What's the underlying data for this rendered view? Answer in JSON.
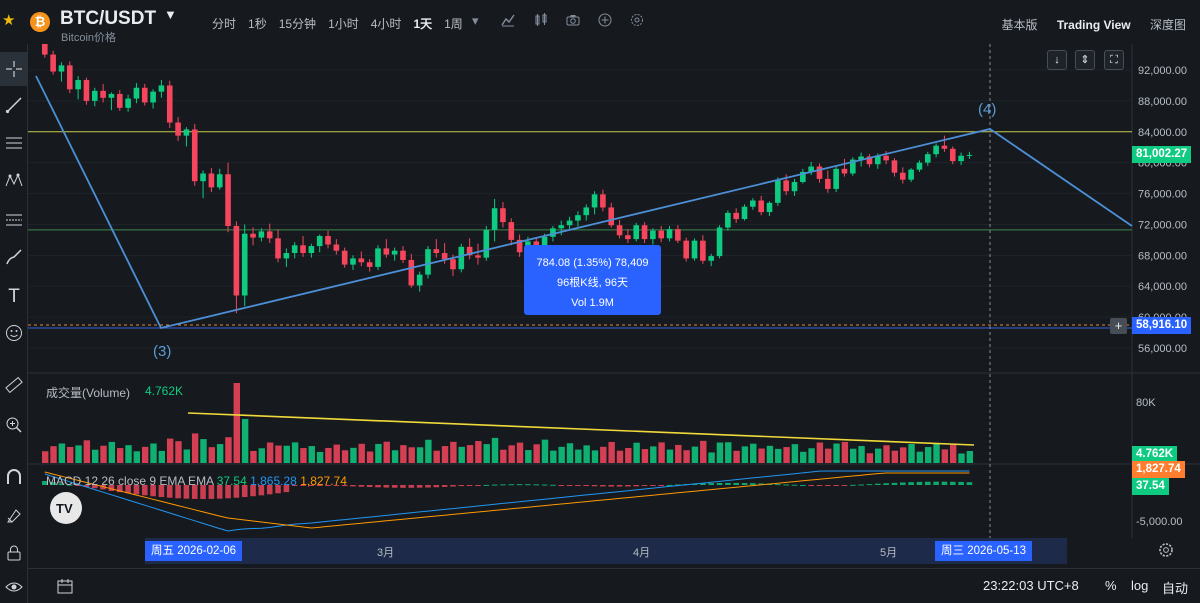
{
  "header": {
    "coin_symbol_icon": "₿",
    "symbol": "BTC/USDT",
    "subtitle": "Bitcoin价格",
    "intervals": [
      "分时",
      "1秒",
      "15分钟",
      "1小时",
      "4小时",
      "1天",
      "1周"
    ],
    "active_interval": "1天",
    "views": [
      "基本版",
      "Trading View",
      "深度图"
    ],
    "active_view": "Trading View"
  },
  "price_axis": {
    "labels": [
      "92,000.00",
      "88,000.00",
      "84,000.00",
      "80,000.00",
      "76,000.00",
      "72,000.00",
      "68,000.00",
      "64,000.00",
      "60,000.00",
      "56,000.00"
    ],
    "current_price": "81,002.27",
    "crosshair_price": "58,916.10",
    "current_price_color": "#0ecb81",
    "crosshair_price_color": "#2962ff"
  },
  "wave_labels": {
    "wave3": "(3)",
    "wave4": "(4)"
  },
  "tooltip": {
    "line1": "784.08 (1.35%) 78,409",
    "line2": "96根K线, 96天",
    "line3": "Vol 1.9M"
  },
  "volume": {
    "title": "成交量(Volume)",
    "value": "4.762K",
    "axis_label": "80K",
    "tag": "4.762K"
  },
  "macd": {
    "title": "MACD 12 26 close 9 EMA EMA",
    "hist": "37.54",
    "macd_line": "1,865.28",
    "signal": "1,827.74",
    "axis_label": "-5,000.00",
    "tag_signal": "1,827.74",
    "tag_hist": "37.54",
    "colors": {
      "hist": "#0ecb81",
      "macd": "#2196f3",
      "signal": "#ff9800"
    }
  },
  "time_axis": {
    "start_tag": "周五 2026-02-06",
    "end_tag": "周三 2026-05-13",
    "months": [
      "3月",
      "4月",
      "5月"
    ]
  },
  "status": {
    "time": "23:22:03 UTC+8",
    "percent": "%",
    "log": "log",
    "auto": "自动"
  },
  "watermark": "TV",
  "colors": {
    "up": "#0ecb81",
    "down": "#f6465d",
    "trendline": "#4d8fd6",
    "hline_yellow": "#c8c84b",
    "hline_green": "#3b8a4e"
  },
  "chart_data": {
    "type": "candlestick",
    "price_range": [
      54000,
      94000
    ],
    "h_lines": [
      84000,
      71300
    ],
    "wave_points": [
      {
        "label": "(3)",
        "price": 58000
      },
      {
        "label": "(4)",
        "price": 84000
      }
    ],
    "candles": [
      [
        95500,
        96200,
        93600,
        94000
      ],
      [
        94000,
        94500,
        91400,
        91800
      ],
      [
        91800,
        93000,
        90500,
        92600
      ],
      [
        92600,
        93100,
        89000,
        89500
      ],
      [
        89500,
        91200,
        88200,
        90700
      ],
      [
        90700,
        91000,
        87500,
        88000
      ],
      [
        88000,
        89700,
        87300,
        89300
      ],
      [
        89300,
        90200,
        87800,
        88400
      ],
      [
        88400,
        89100,
        86800,
        88900
      ],
      [
        88900,
        89400,
        86700,
        87100
      ],
      [
        87100,
        88800,
        86600,
        88300
      ],
      [
        88300,
        90300,
        87700,
        89700
      ],
      [
        89700,
        90200,
        87400,
        87800
      ],
      [
        87800,
        89500,
        87000,
        89200
      ],
      [
        89200,
        90700,
        88400,
        90000
      ],
      [
        90000,
        90600,
        84500,
        85200
      ],
      [
        85200,
        85900,
        82800,
        83500
      ],
      [
        83500,
        84600,
        82100,
        84300
      ],
      [
        84300,
        85000,
        77000,
        77600
      ],
      [
        77600,
        79000,
        75400,
        78600
      ],
      [
        78600,
        79300,
        76200,
        76800
      ],
      [
        76800,
        79200,
        76500,
        78500
      ],
      [
        78500,
        80000,
        71000,
        71800
      ],
      [
        71800,
        72400,
        60500,
        62800
      ],
      [
        62800,
        72000,
        61400,
        70800
      ],
      [
        70800,
        71600,
        69300,
        70300
      ],
      [
        70300,
        71500,
        69800,
        71100
      ],
      [
        71100,
        72100,
        69600,
        70200
      ],
      [
        70200,
        71400,
        67100,
        67600
      ],
      [
        67600,
        68900,
        66500,
        68300
      ],
      [
        68300,
        69700,
        67600,
        69300
      ],
      [
        69300,
        70500,
        67800,
        68300
      ],
      [
        68300,
        69500,
        67700,
        69200
      ],
      [
        69200,
        70700,
        68400,
        70500
      ],
      [
        70500,
        71200,
        68900,
        69400
      ],
      [
        69400,
        70100,
        68100,
        68600
      ],
      [
        68600,
        69000,
        66400,
        66800
      ],
      [
        66800,
        68000,
        66100,
        67600
      ],
      [
        67600,
        68500,
        66600,
        67100
      ],
      [
        67100,
        67500,
        65900,
        66500
      ],
      [
        66500,
        69300,
        66100,
        68900
      ],
      [
        68900,
        70100,
        67700,
        68100
      ],
      [
        68100,
        69000,
        67300,
        68600
      ],
      [
        68600,
        69200,
        67000,
        67400
      ],
      [
        67400,
        68200,
        63800,
        64100
      ],
      [
        64100,
        65900,
        63300,
        65500
      ],
      [
        65500,
        69200,
        65000,
        68800
      ],
      [
        68800,
        70100,
        67700,
        68300
      ],
      [
        68300,
        69600,
        66900,
        67500
      ],
      [
        67500,
        68100,
        65300,
        66200
      ],
      [
        66200,
        69500,
        65800,
        69100
      ],
      [
        69100,
        70200,
        67500,
        68000
      ],
      [
        68000,
        69500,
        66800,
        67700
      ],
      [
        67700,
        71800,
        67300,
        71300
      ],
      [
        71300,
        75300,
        69800,
        74100
      ],
      [
        74100,
        74900,
        71600,
        72300
      ],
      [
        72300,
        72800,
        69300,
        70000
      ],
      [
        70000,
        70700,
        67800,
        68400
      ],
      [
        68400,
        70400,
        67700,
        69800
      ],
      [
        69800,
        70200,
        66700,
        67200
      ],
      [
        67200,
        70800,
        67000,
        70400
      ],
      [
        70400,
        71800,
        69800,
        71500
      ],
      [
        71500,
        72500,
        70600,
        71900
      ],
      [
        71900,
        73000,
        71300,
        72500
      ],
      [
        72500,
        73700,
        71700,
        73200
      ],
      [
        73200,
        74600,
        72500,
        74200
      ],
      [
        74200,
        76300,
        73300,
        75900
      ],
      [
        75900,
        76500,
        73700,
        74200
      ],
      [
        74200,
        74800,
        71600,
        71900
      ],
      [
        71900,
        72600,
        70200,
        70600
      ],
      [
        70600,
        71400,
        69600,
        70100
      ],
      [
        70100,
        72200,
        69800,
        71900
      ],
      [
        71900,
        72300,
        69600,
        70100
      ],
      [
        70100,
        71500,
        69400,
        71200
      ],
      [
        71200,
        71800,
        69700,
        70200
      ],
      [
        70200,
        71800,
        69800,
        71400
      ],
      [
        71400,
        71900,
        69600,
        69900
      ],
      [
        69900,
        70300,
        67200,
        67600
      ],
      [
        67600,
        70200,
        67300,
        69900
      ],
      [
        69900,
        70600,
        66900,
        67300
      ],
      [
        67300,
        68200,
        66600,
        67900
      ],
      [
        67900,
        71900,
        67600,
        71600
      ],
      [
        71600,
        73800,
        71200,
        73500
      ],
      [
        73500,
        74100,
        72200,
        72700
      ],
      [
        72700,
        74600,
        72500,
        74300
      ],
      [
        74300,
        75400,
        73900,
        75100
      ],
      [
        75100,
        75700,
        73200,
        73600
      ],
      [
        73600,
        75000,
        73100,
        74800
      ],
      [
        74800,
        78100,
        74400,
        77700
      ],
      [
        77700,
        78500,
        75800,
        76300
      ],
      [
        76300,
        77900,
        75700,
        77500
      ],
      [
        77500,
        79200,
        77300,
        78800
      ],
      [
        78800,
        80100,
        78400,
        79500
      ],
      [
        79500,
        79900,
        77400,
        77900
      ],
      [
        77900,
        79000,
        76100,
        76600
      ],
      [
        76600,
        79600,
        76200,
        79200
      ],
      [
        79200,
        80500,
        78200,
        78600
      ],
      [
        78600,
        80700,
        78300,
        80400
      ],
      [
        80400,
        81300,
        79500,
        80800
      ],
      [
        80800,
        81100,
        79400,
        79800
      ],
      [
        79800,
        81200,
        79200,
        80900
      ],
      [
        80900,
        81500,
        79800,
        80300
      ],
      [
        80300,
        80600,
        78200,
        78700
      ],
      [
        78700,
        79400,
        77300,
        77800
      ],
      [
        77800,
        79300,
        77500,
        79100
      ],
      [
        79100,
        80300,
        78800,
        80000
      ],
      [
        80000,
        81400,
        79600,
        81100
      ],
      [
        81100,
        82500,
        80700,
        82200
      ],
      [
        82200,
        83500,
        81400,
        81800
      ],
      [
        81800,
        82100,
        79800,
        80200
      ],
      [
        80200,
        81300,
        79700,
        80900
      ],
      [
        80900,
        81400,
        80500,
        81002
      ]
    ]
  }
}
